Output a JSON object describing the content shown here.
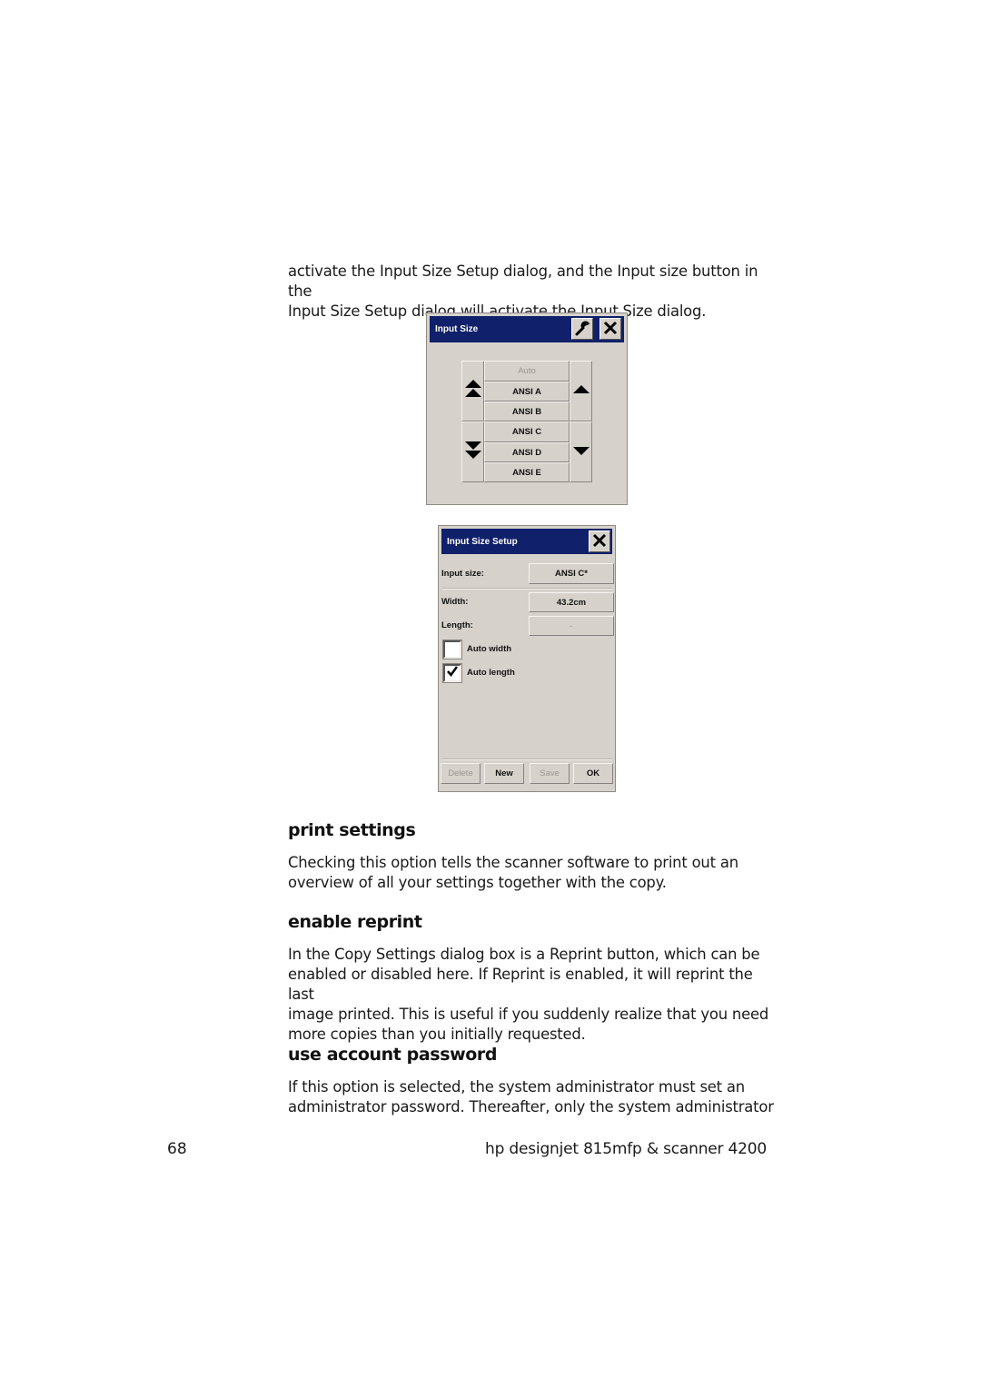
{
  "intro": {
    "line1": "activate the Input Size Setup dialog, and the Input size button in the",
    "line2": "Input Size Setup dialog will activate the Input Size dialog."
  },
  "input_size_dialog": {
    "title": "Input Size",
    "tools_icon": "wrench-icon",
    "close_icon": "close-icon",
    "sizes": [
      {
        "label": "Auto",
        "enabled": false
      },
      {
        "label": "ANSI A",
        "enabled": true
      },
      {
        "label": "ANSI B",
        "enabled": true
      },
      {
        "label": "ANSI C",
        "enabled": true
      },
      {
        "label": "ANSI D",
        "enabled": true
      },
      {
        "label": "ANSI E",
        "enabled": true
      }
    ],
    "scroll_icons": [
      "double-arrow-up-icon",
      "arrow-up-icon",
      "double-arrow-down-icon",
      "arrow-down-icon"
    ]
  },
  "input_size_setup_dialog": {
    "title": "Input Size Setup",
    "close_icon": "close-icon",
    "input_size_label": "Input size:",
    "input_size_value": "ANSI C*",
    "width_label": "Width:",
    "width_value": "43.2cm",
    "length_label": "Length:",
    "length_value": "-",
    "auto_width_label": "Auto width",
    "auto_width_checked": false,
    "auto_length_label": "Auto length",
    "auto_length_checked": true,
    "buttons": {
      "delete": "Delete",
      "new": "New",
      "save": "Save",
      "ok": "OK"
    }
  },
  "sections": [
    {
      "heading": "print settings",
      "lines": [
        "Checking this option tells the scanner software to print out an",
        "overview of all your settings together with the copy."
      ]
    },
    {
      "heading": "enable reprint",
      "lines": [
        "In the Copy Settings dialog box is a Reprint button, which can be",
        "enabled or disabled here. If Reprint is enabled, it will reprint the last",
        "image printed. This is useful if you suddenly realize that you need",
        "more copies than you initially requested."
      ]
    },
    {
      "heading": "use account password",
      "lines": [
        "If this option is selected, the system administrator must set an",
        "administrator password. Thereafter, only the system administrator"
      ]
    }
  ],
  "footer": {
    "page_number": "68",
    "title": "hp designjet 815mfp & scanner 4200"
  }
}
